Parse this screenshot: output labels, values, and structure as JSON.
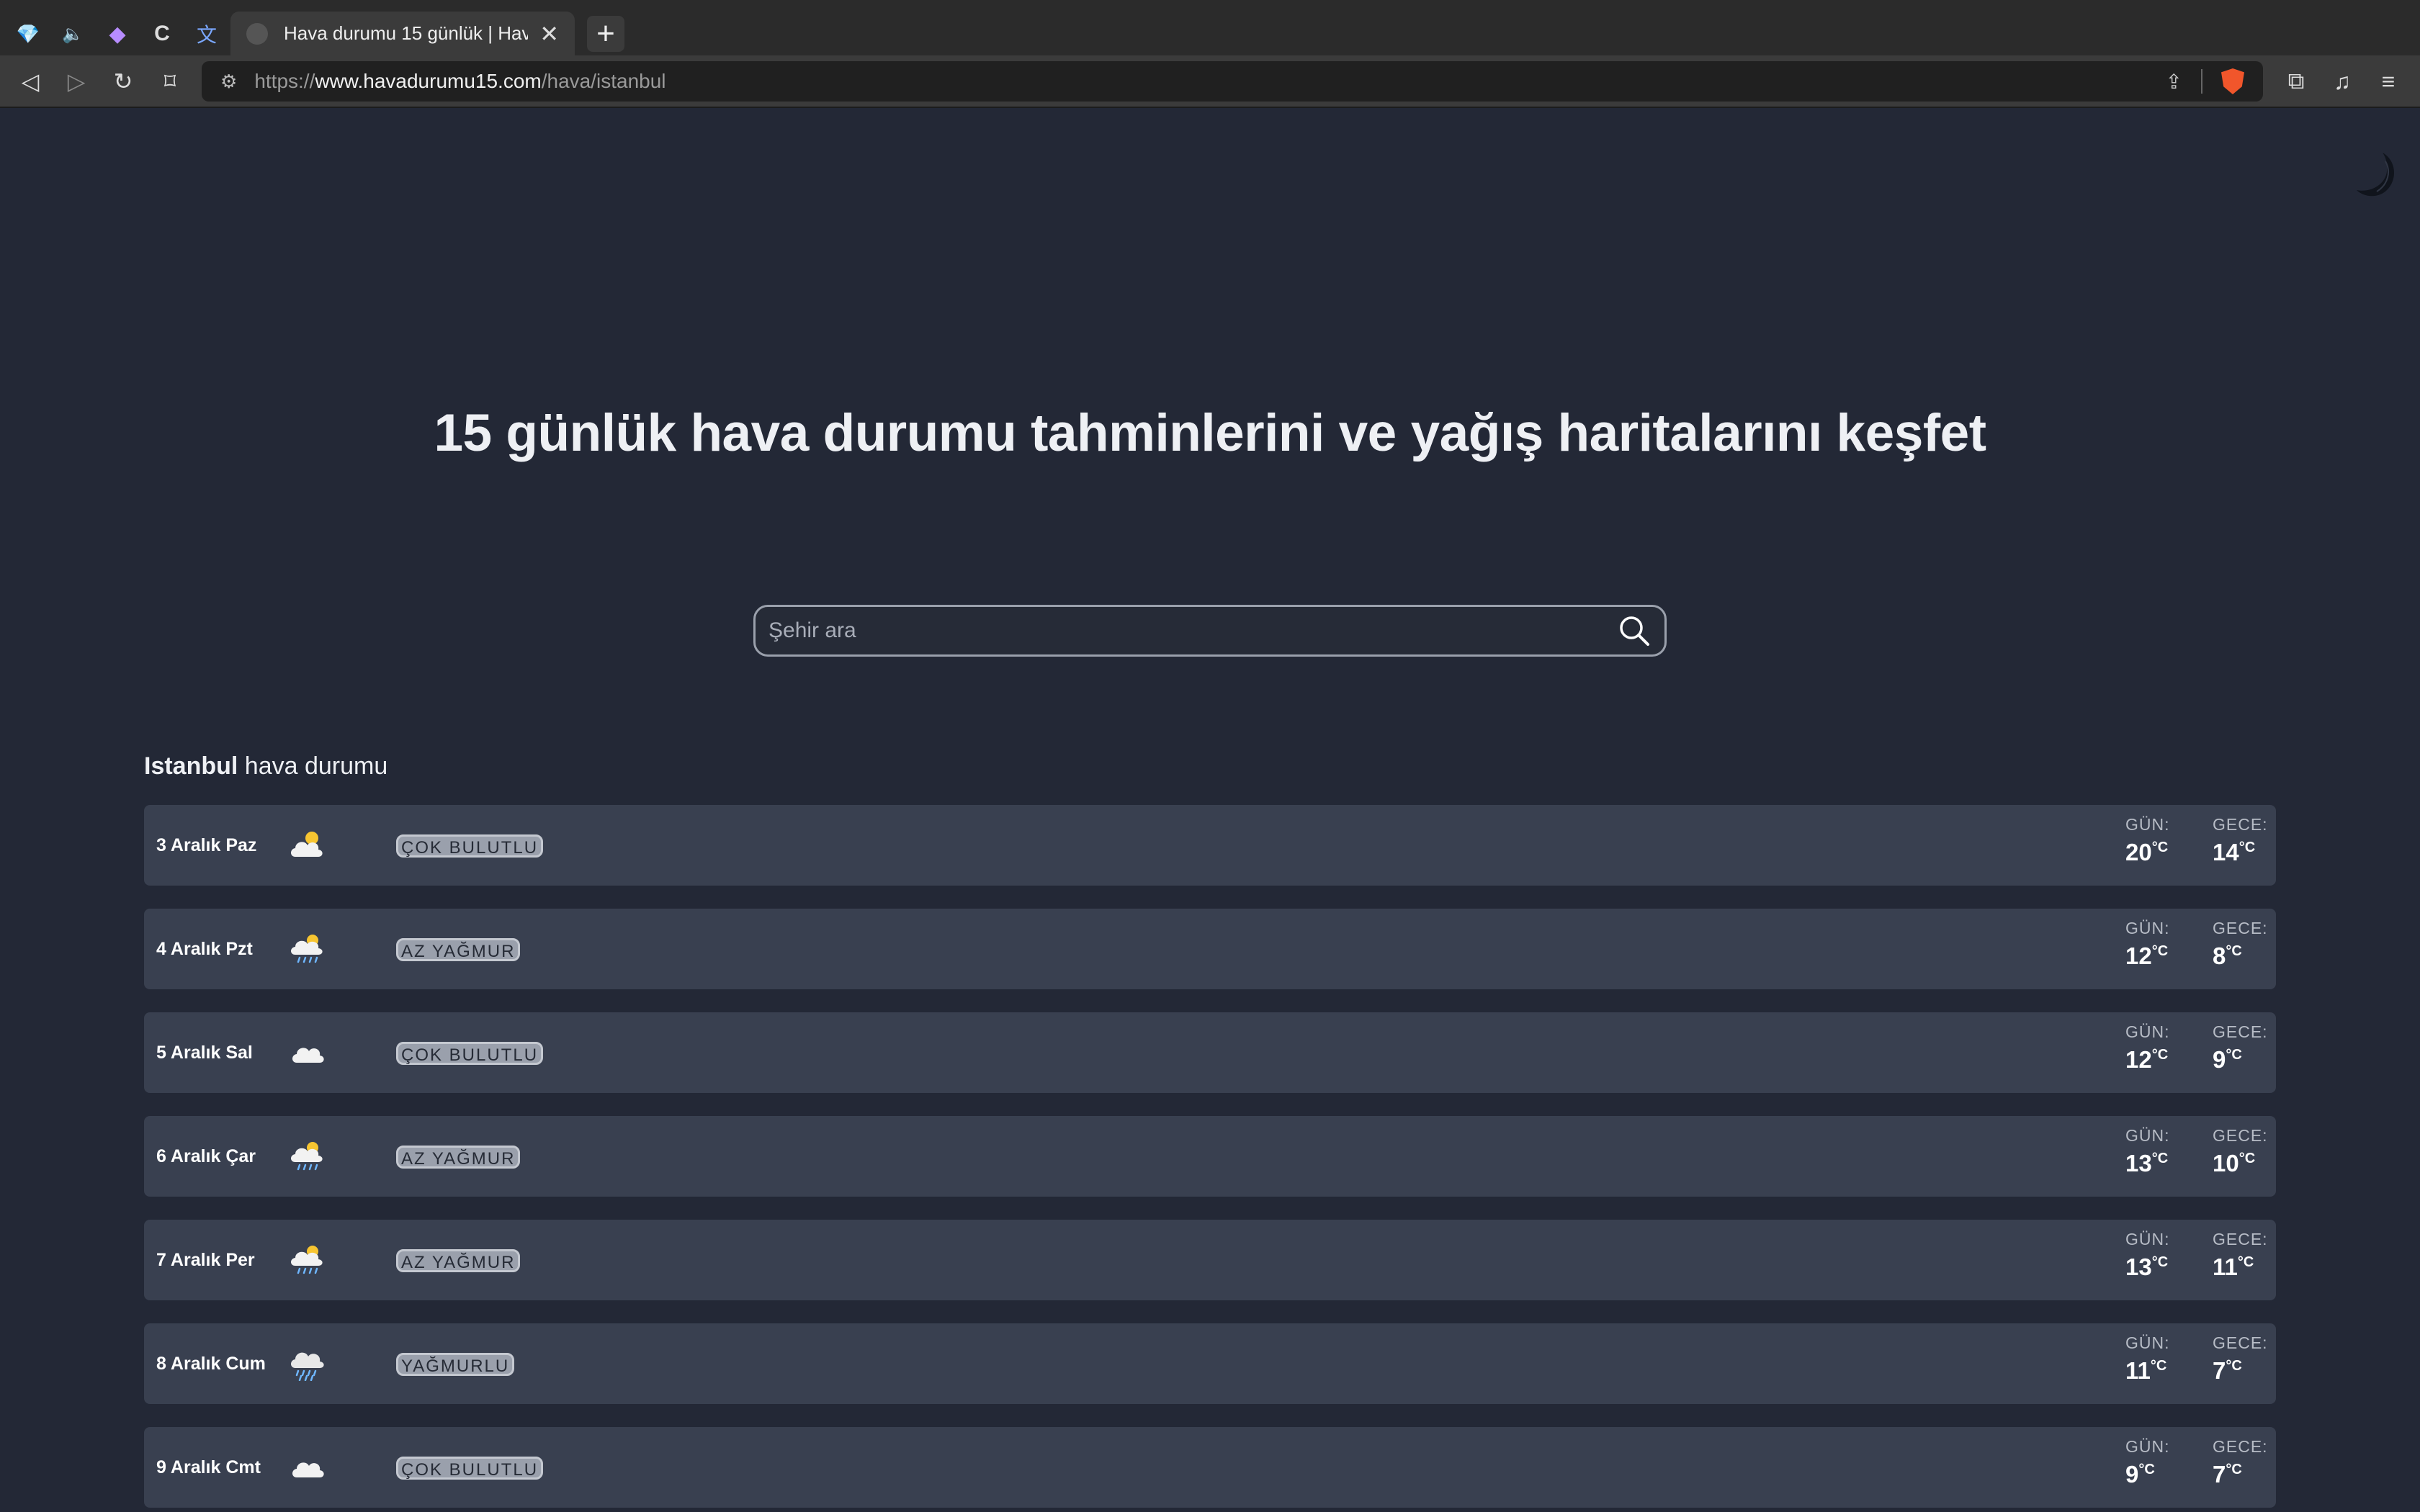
{
  "browser": {
    "pinned_tabs": [
      {
        "icon": "diamond-icon",
        "glyph": "💎"
      },
      {
        "icon": "speaker-icon",
        "glyph": "🔈"
      },
      {
        "icon": "app-icon",
        "glyph": "◆"
      },
      {
        "icon": "c-letter-icon",
        "glyph": "C"
      },
      {
        "icon": "translate-icon",
        "glyph": "文"
      }
    ],
    "active_tab": {
      "title": "Hava durumu 15 günlük | Hava",
      "close_glyph": "✕"
    },
    "new_tab_glyph": "+",
    "nav": {
      "back": "◁",
      "forward": "▷",
      "reload": "↻",
      "bookmark": "⌑"
    },
    "url": {
      "scheme": "https://",
      "host": "www.havadurumu15.com",
      "path": "/hava/istanbul",
      "site_info_glyph": "⚙"
    },
    "actions": {
      "share": "⇪",
      "extensions": "⧉",
      "media": "♫",
      "menu": "≡"
    }
  },
  "page": {
    "title": "15 günlük hava durumu tahminlerini ve yağış haritalarını keşfet",
    "search": {
      "placeholder": "Şehir ara",
      "value": ""
    },
    "heading": {
      "city": "Istanbul",
      "suffix": " hava durumu"
    },
    "labels": {
      "day": "GÜN:",
      "night": "GECE:",
      "unit": "°C"
    },
    "days": [
      {
        "date": "3 Aralık Paz",
        "icon": "partly-cloudy-sun-icon",
        "condition": "ÇOK BULUTLU",
        "day_temp": "20",
        "night_temp": "14"
      },
      {
        "date": "4 Aralık Pzt",
        "icon": "sun-rain-cloud-icon",
        "condition": "AZ YAĞMUR",
        "day_temp": "12",
        "night_temp": "8"
      },
      {
        "date": "5 Aralık Sal",
        "icon": "cloud-icon",
        "condition": "ÇOK BULUTLU",
        "day_temp": "12",
        "night_temp": "9"
      },
      {
        "date": "6 Aralık Çar",
        "icon": "sun-rain-cloud-icon",
        "condition": "AZ YAĞMUR",
        "day_temp": "13",
        "night_temp": "10"
      },
      {
        "date": "7 Aralık Per",
        "icon": "sun-rain-cloud-icon",
        "condition": "AZ YAĞMUR",
        "day_temp": "13",
        "night_temp": "11"
      },
      {
        "date": "8 Aralık Cum",
        "icon": "rain-cloud-icon",
        "condition": "YAĞMURLU",
        "day_temp": "11",
        "night_temp": "7"
      },
      {
        "date": "9 Aralık Cmt",
        "icon": "cloud-icon",
        "condition": "ÇOK BULUTLU",
        "day_temp": "9",
        "night_temp": "7"
      }
    ]
  }
}
